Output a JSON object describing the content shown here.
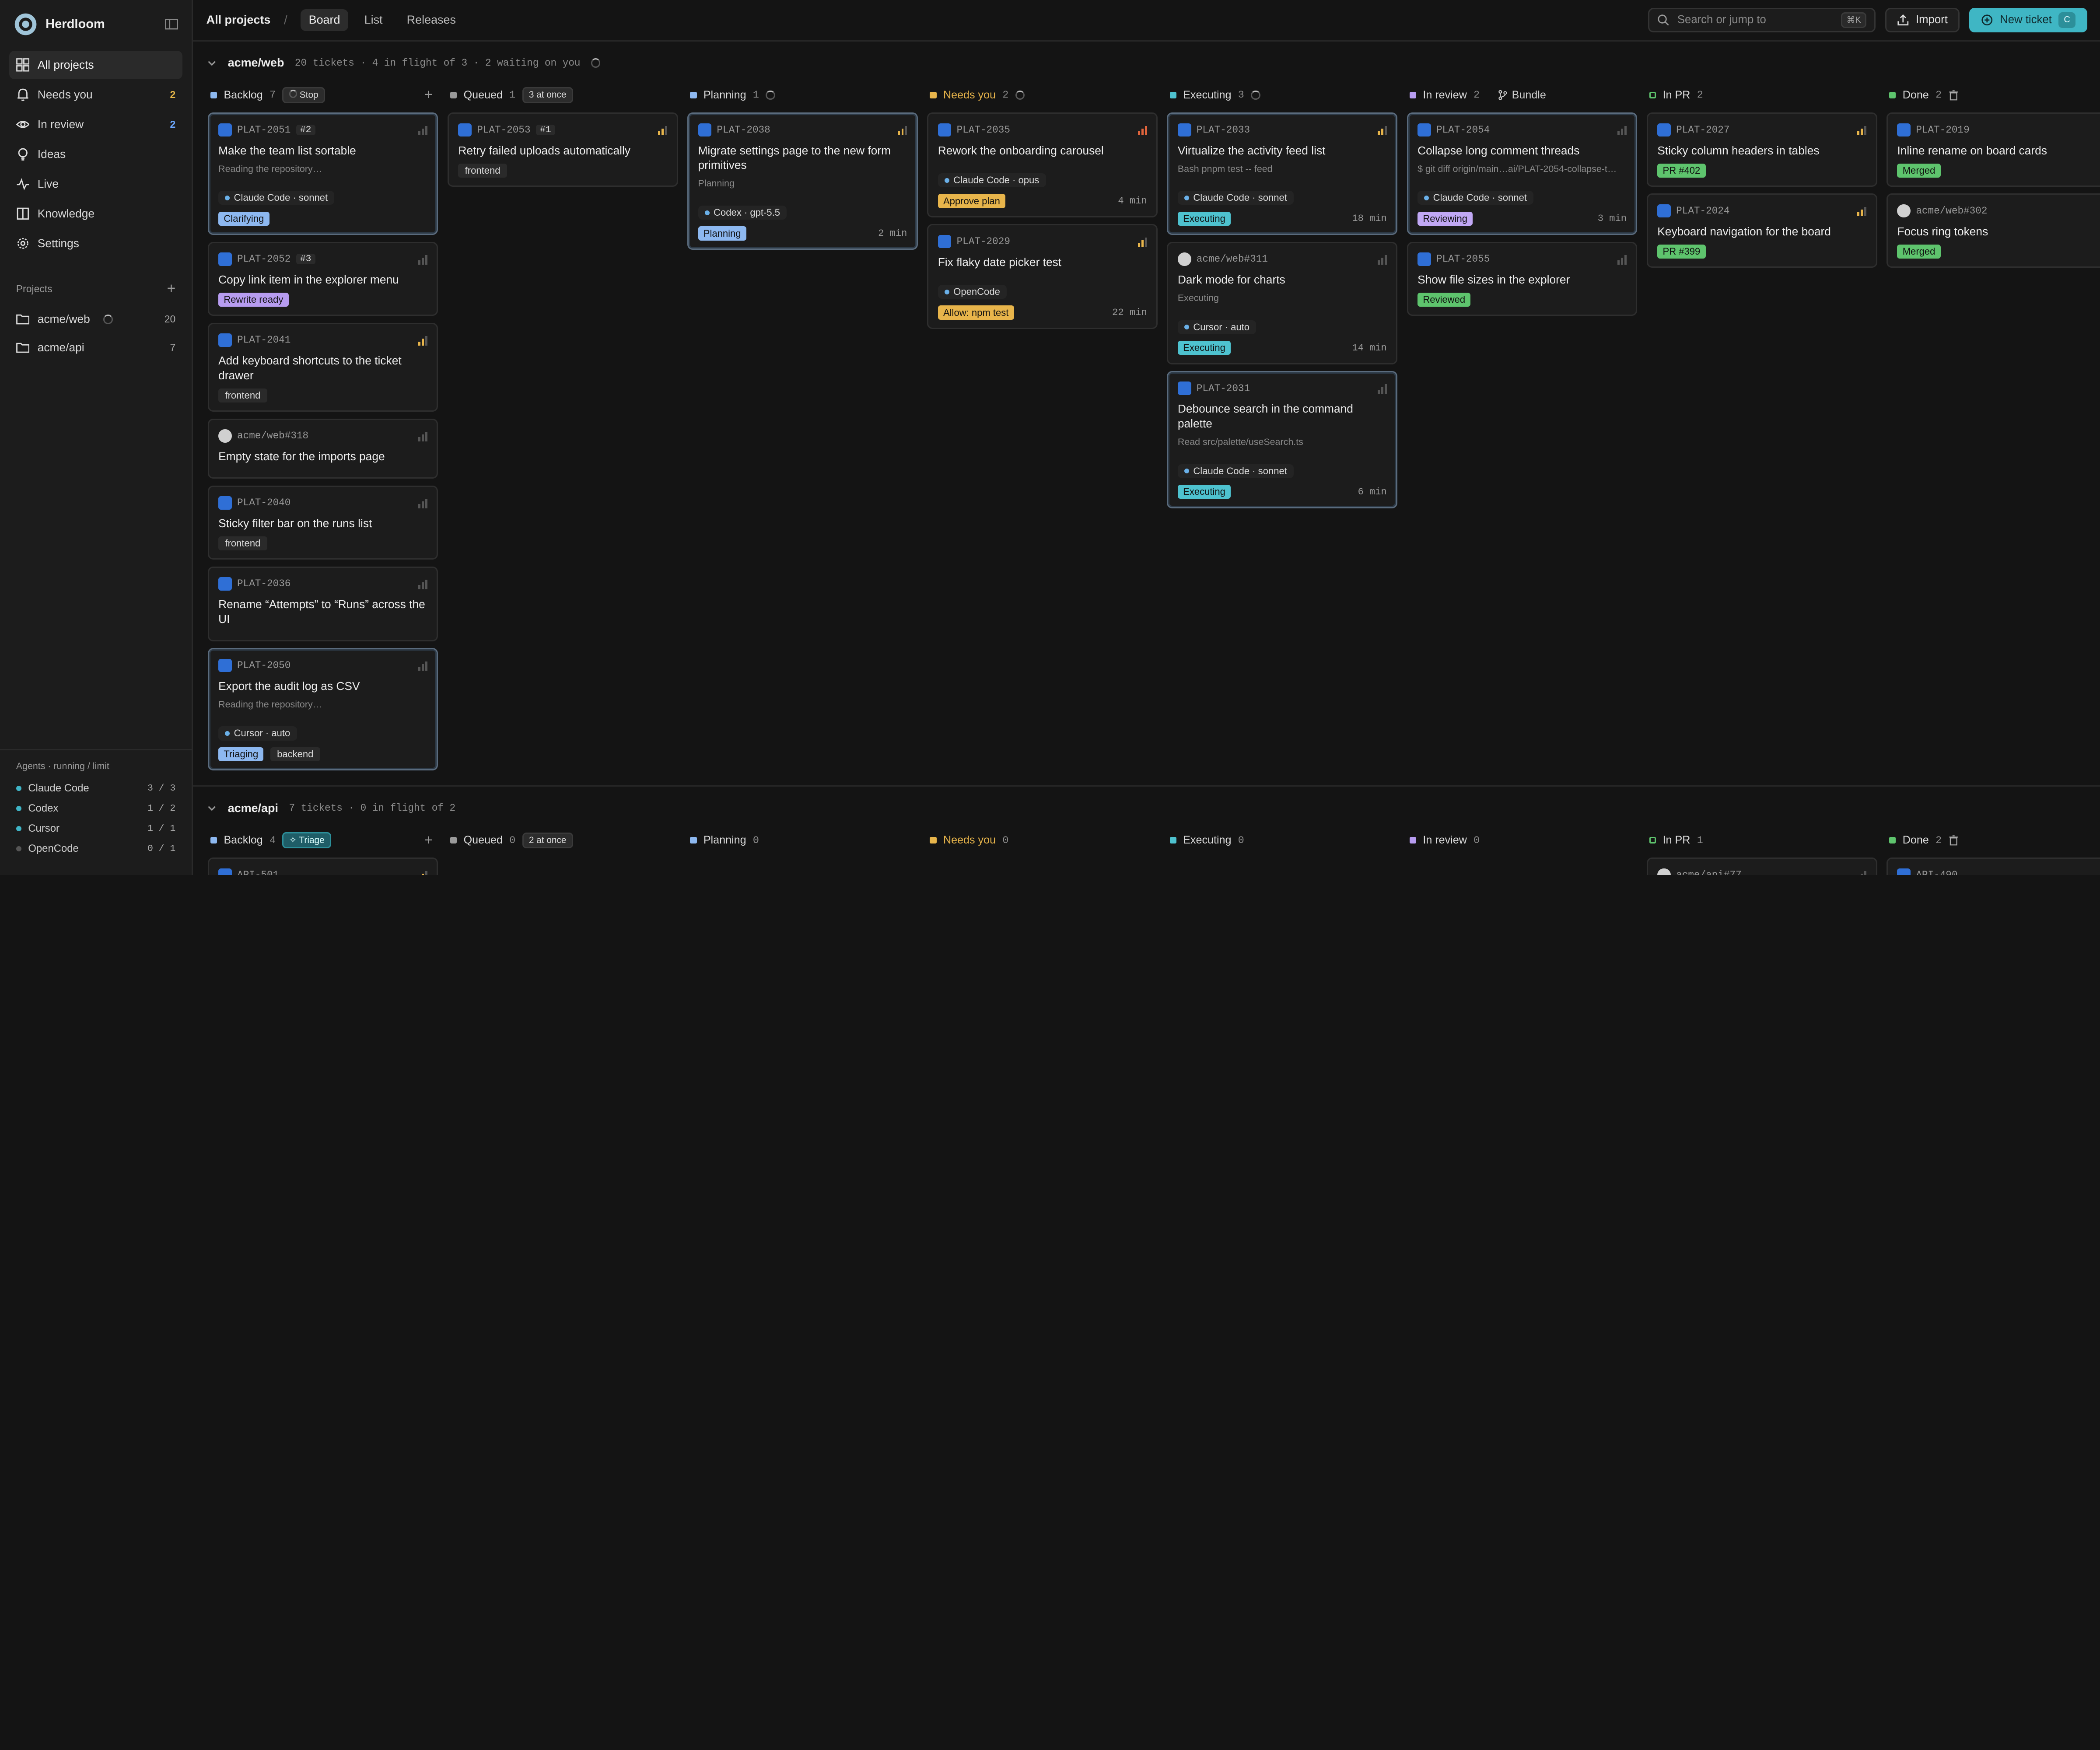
{
  "brand": {
    "name": "Herdloom"
  },
  "nav": [
    {
      "label": "All projects",
      "count": ""
    },
    {
      "label": "Needs you",
      "count": "2"
    },
    {
      "label": "In review",
      "count": "2"
    },
    {
      "label": "Ideas",
      "count": ""
    },
    {
      "label": "Live",
      "count": ""
    },
    {
      "label": "Knowledge",
      "count": ""
    },
    {
      "label": "Settings",
      "count": ""
    }
  ],
  "projects_section": {
    "title": "Projects",
    "plus": "+"
  },
  "projects": [
    {
      "name": "acme/web",
      "count": "20"
    },
    {
      "name": "acme/api",
      "count": "7"
    }
  ],
  "agents": {
    "title": "Agents · running / limit",
    "items": [
      {
        "name": "Claude Code",
        "value": "3 / 3"
      },
      {
        "name": "Codex",
        "value": "1 / 2"
      },
      {
        "name": "Cursor",
        "value": "1 / 1"
      },
      {
        "name": "OpenCode",
        "value": "0 / 1"
      }
    ]
  },
  "topbar": {
    "crumb": "All projects",
    "sep": "/",
    "tabs": [
      "Board",
      "List",
      "Releases"
    ],
    "search_placeholder": "Search or jump to",
    "search_kbd": "⌘K",
    "import": "Import",
    "new_ticket": "New ticket",
    "new_kbd": "C"
  },
  "web": {
    "name": "acme/web",
    "meta": "20 tickets · 4 in flight of 3 · 2 waiting on you",
    "cols": {
      "backlog": {
        "label": "Backlog",
        "count": "7",
        "chip": "Stop",
        "plus": "+"
      },
      "queued": {
        "label": "Queued",
        "count": "1",
        "chip": "3 at once"
      },
      "planning": {
        "label": "Planning",
        "count": "1"
      },
      "needs": {
        "label": "Needs you",
        "count": "2"
      },
      "executing": {
        "label": "Executing",
        "count": "3"
      },
      "review": {
        "label": "In review",
        "count": "2",
        "bundle": "Bundle"
      },
      "inpr": {
        "label": "In PR",
        "count": "2"
      },
      "done": {
        "label": "Done",
        "count": "2"
      }
    },
    "backlog": [
      {
        "key": "PLAT-2051",
        "num": "#2",
        "title": "Make the team list sortable",
        "sub": "Reading the repository…",
        "agent": "Claude Code · sonnet",
        "badge": "Clarifying"
      },
      {
        "key": "PLAT-2052",
        "num": "#3",
        "title": "Copy link item in the explorer menu",
        "badge": "Rewrite ready"
      },
      {
        "key": "PLAT-2041",
        "title": "Add keyboard shortcuts to the ticket drawer",
        "tag": "frontend"
      },
      {
        "key": "acme/web#318",
        "title": "Empty state for the imports page"
      },
      {
        "key": "PLAT-2040",
        "title": "Sticky filter bar on the runs list",
        "tag": "frontend"
      },
      {
        "key": "PLAT-2036",
        "title": "Rename “Attempts” to “Runs” across the UI"
      },
      {
        "key": "PLAT-2050",
        "title": "Export the audit log as CSV",
        "sub": "Reading the repository…",
        "agent": "Cursor · auto",
        "badge": "Triaging",
        "tag": "backend"
      }
    ],
    "queued": [
      {
        "key": "PLAT-2053",
        "num": "#1",
        "title": "Retry failed uploads automatically",
        "tag": "frontend"
      }
    ],
    "planning": [
      {
        "key": "PLAT-2038",
        "title": "Migrate settings page to the new form primitives",
        "sub": "Planning",
        "agent": "Codex · gpt-5.5",
        "badge": "Planning",
        "time": "2 min"
      }
    ],
    "needs": [
      {
        "key": "PLAT-2035",
        "title": "Rework the onboarding carousel",
        "agent": "Claude Code · opus",
        "badge": "Approve plan",
        "time": "4 min"
      },
      {
        "key": "PLAT-2029",
        "title": "Fix flaky date picker test",
        "agent": "OpenCode",
        "badge": "Allow: npm test",
        "time": "22 min"
      }
    ],
    "executing": [
      {
        "key": "PLAT-2033",
        "title": "Virtualize the activity feed list",
        "sub": "Bash pnpm test -- feed",
        "agent": "Claude Code · sonnet",
        "badge": "Executing",
        "time": "18 min"
      },
      {
        "key": "acme/web#311",
        "title": "Dark mode for charts",
        "sub": "Executing",
        "agent": "Cursor · auto",
        "badge": "Executing",
        "time": "14 min"
      },
      {
        "key": "PLAT-2031",
        "title": "Debounce search in the command palette",
        "sub": "Read src/palette/useSearch.ts",
        "agent": "Claude Code · sonnet",
        "badge": "Executing",
        "time": "6 min"
      }
    ],
    "review": [
      {
        "key": "PLAT-2054",
        "title": "Collapse long comment threads",
        "sub": "$ git diff origin/main…ai/PLAT-2054-collapse-t…",
        "agent": "Claude Code · sonnet",
        "badge": "Reviewing",
        "time": "3 min"
      },
      {
        "key": "PLAT-2055",
        "title": "Show file sizes in the explorer",
        "badge": "Reviewed"
      }
    ],
    "inpr": [
      {
        "key": "PLAT-2027",
        "title": "Sticky column headers in tables",
        "badge": "PR #402"
      },
      {
        "key": "PLAT-2024",
        "title": "Keyboard navigation for the board",
        "badge": "PR #399"
      }
    ],
    "done": [
      {
        "key": "PLAT-2019",
        "title": "Inline rename on board cards",
        "badge": "Merged"
      },
      {
        "key": "acme/web#302",
        "title": "Focus ring tokens",
        "badge": "Merged"
      }
    ]
  },
  "api": {
    "name": "acme/api",
    "meta": "7 tickets · 0 in flight of 2",
    "cols": {
      "backlog": {
        "label": "Backlog",
        "count": "4",
        "chip": "Triage",
        "plus": "+"
      },
      "queued": {
        "label": "Queued",
        "count": "0",
        "chip": "2 at once"
      },
      "planning": {
        "label": "Planning",
        "count": "0"
      },
      "needs": {
        "label": "Needs you",
        "count": "0"
      },
      "executing": {
        "label": "Executing",
        "count": "0"
      },
      "review": {
        "label": "In review",
        "count": "0"
      },
      "inpr": {
        "label": "In PR",
        "count": "1"
      },
      "done": {
        "label": "Done",
        "count": "2"
      }
    },
    "backlog_first": "API-501",
    "inpr_first": "acme/api#77",
    "done_first": "API-490"
  },
  "colors": {
    "accent": "#3fb6c4",
    "backlog": "#8db8f0",
    "needs": "#e8b54b",
    "executing": "#4ec2cf",
    "review": "#b79cf0",
    "inpr": "#5ec46d",
    "done": "#5ec46d"
  }
}
